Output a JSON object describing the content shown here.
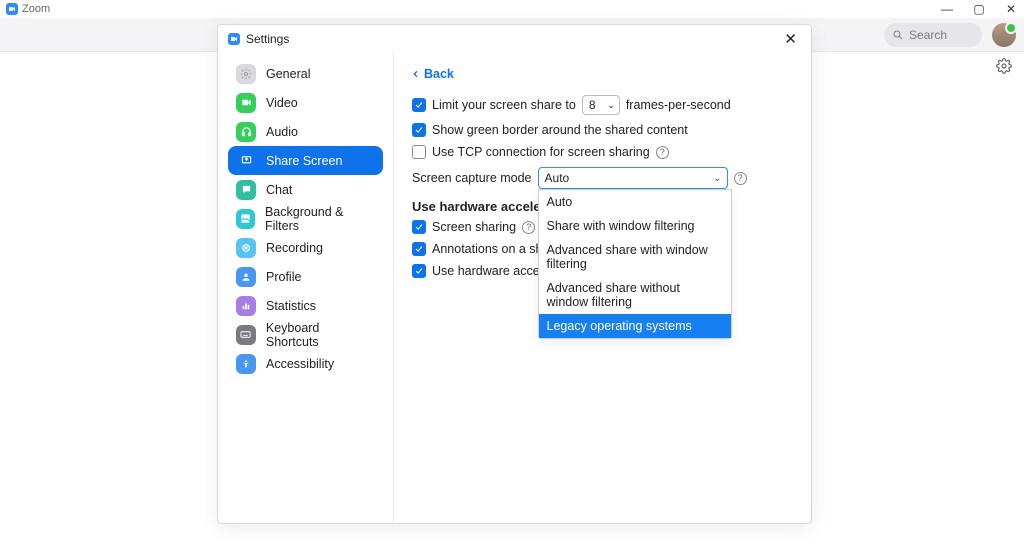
{
  "window": {
    "title": "Zoom"
  },
  "topbar": {
    "search_placeholder": "Search"
  },
  "modal": {
    "title": "Settings",
    "close": "✕"
  },
  "sidebar": {
    "items": [
      {
        "label": "General"
      },
      {
        "label": "Video"
      },
      {
        "label": "Audio"
      },
      {
        "label": "Share Screen",
        "active": true
      },
      {
        "label": "Chat"
      },
      {
        "label": "Background & Filters"
      },
      {
        "label": "Recording"
      },
      {
        "label": "Profile"
      },
      {
        "label": "Statistics"
      },
      {
        "label": "Keyboard Shortcuts"
      },
      {
        "label": "Accessibility"
      }
    ]
  },
  "content": {
    "back": "Back",
    "limit_fps_prefix": "Limit your screen share to",
    "limit_fps_value": "8",
    "limit_fps_suffix": "frames-per-second",
    "green_border": "Show green border around the shared content",
    "tcp": "Use TCP connection for screen sharing",
    "capture_mode_label": "Screen capture mode",
    "capture_mode_value": "Auto",
    "capture_mode_options": [
      "Auto",
      "Share with window filtering",
      "Advanced share with window filtering",
      "Advanced share without window filtering",
      "Legacy operating systems"
    ],
    "capture_mode_highlight_index": 4,
    "hw_accel_heading": "Use hardware acceleration for",
    "hw_screen": "Screen sharing",
    "hw_anno": "Annotations on a shared screen or whiteboard",
    "hw_video": "Use hardware acceleration to optimize video sharing"
  }
}
